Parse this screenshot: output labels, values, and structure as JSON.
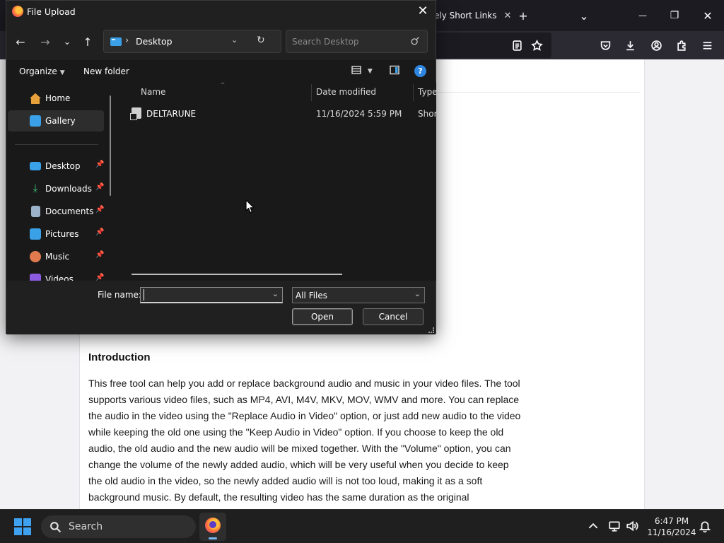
{
  "browser": {
    "tab_label": "ely Short Links",
    "tab_close": "✕",
    "new_tab": "+",
    "list_tabs": "⌄",
    "minimize": "—",
    "restore": "❐",
    "close": "✕"
  },
  "article": {
    "heading": "Introduction",
    "body": "This free tool can help you add or replace background audio and music in your video files. The tool supports various video files, such as MP4, AVI, M4V, MKV, MOV, WMV and more. You can replace the audio in the video using the \"Replace Audio in Video\" option, or just add new audio to the video while keeping the old one using the \"Keep Audio in Video\" option. If you choose to keep the old audio, the old audio and the new audio will be mixed together. With the \"Volume\" option, you can change the volume of the newly added audio, which will be very useful when you decide to keep the old audio in the video, so the newly added audio will is not too loud, making it as a soft background music. By default, the resulting video has the same duration as the original"
  },
  "dialog": {
    "title": "File Upload",
    "close": "✕",
    "nav": {
      "back": "←",
      "forward": "→",
      "recent": "⌄",
      "up": "↑"
    },
    "address": {
      "separator": "›",
      "path": "Desktop",
      "dropdown": "⌄",
      "refresh": "↻"
    },
    "search": {
      "placeholder": "Search Desktop"
    },
    "commands": {
      "organize": "Organize",
      "new_folder": "New folder"
    },
    "sidebar": {
      "items": [
        {
          "label": "Home",
          "pinned": false
        },
        {
          "label": "Gallery",
          "pinned": false,
          "selected": true
        },
        {
          "label": "Desktop",
          "pinned": true
        },
        {
          "label": "Downloads",
          "pinned": true
        },
        {
          "label": "Documents",
          "pinned": true
        },
        {
          "label": "Pictures",
          "pinned": true
        },
        {
          "label": "Music",
          "pinned": true
        },
        {
          "label": "Videos",
          "pinned": true
        }
      ]
    },
    "columns": {
      "name": "Name",
      "date": "Date modified",
      "type": "Type"
    },
    "files": [
      {
        "name": "DELTARUNE",
        "date": "11/16/2024 5:59 PM",
        "type": "Short"
      }
    ],
    "file_name_label": "File name:",
    "file_name_value": "",
    "filter": "All Files",
    "open_label": "Open",
    "cancel_label": "Cancel"
  },
  "taskbar": {
    "search_label": "Search",
    "time": "6:47 PM",
    "date": "11/16/2024"
  },
  "colors": {
    "dialog_bg": "#191919",
    "accent": "#3aa0e8",
    "taskbar": "#1f1f1f",
    "browser_toolbar": "#2b2a33"
  }
}
